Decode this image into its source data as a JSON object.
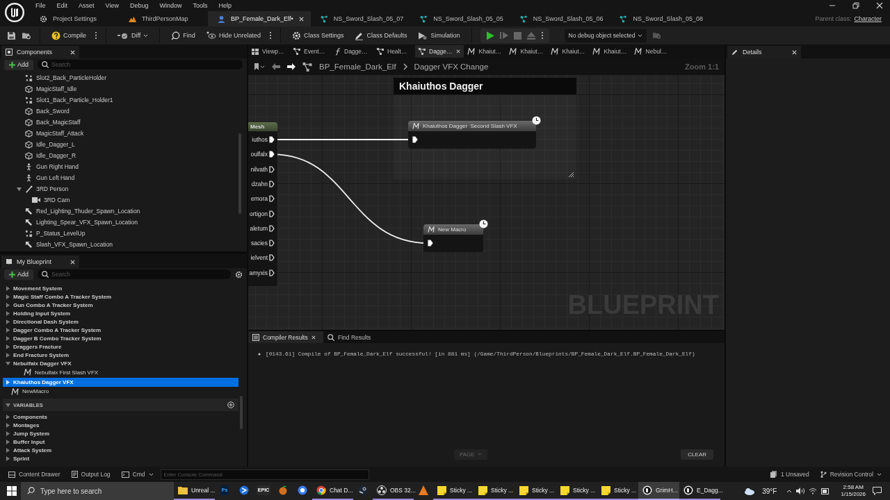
{
  "menu": [
    "File",
    "Edit",
    "Asset",
    "View",
    "Debug",
    "Window",
    "Tools",
    "Help"
  ],
  "doc_tabs": [
    {
      "label": "Project Settings",
      "kind": "settings",
      "selected": false
    },
    {
      "label": "ThirdPersonMap",
      "kind": "map",
      "selected": false
    },
    {
      "label": "BP_Female_Dark_Elf•",
      "kind": "blueprint",
      "selected": true
    },
    {
      "label": "NS_Sword_Slash_05_07",
      "kind": "niagara",
      "selected": false
    },
    {
      "label": "NS_Sword_Slash_05_05",
      "kind": "niagara",
      "selected": false
    },
    {
      "label": "NS_Sword_Slash_05_06",
      "kind": "niagara",
      "selected": false
    },
    {
      "label": "NS_Sword_Slash_05_08",
      "kind": "niagara",
      "selected": false
    }
  ],
  "parent_class": {
    "label": "Parent class:",
    "value": "Character"
  },
  "toolbar": {
    "compile": "Compile",
    "diff": "Diff",
    "find": "Find",
    "hide_unrelated": "Hide Unrelated",
    "class_settings": "Class Settings",
    "class_defaults": "Class Defaults",
    "simulation": "Simulation",
    "debug_object": "No debug object selected"
  },
  "components": {
    "title": "Components",
    "add": "Add",
    "search_placeholder": "Search",
    "items": [
      {
        "label": "Slot2_Back_ParticleHolder",
        "kind": "particle"
      },
      {
        "label": "MagicStaff_Idle",
        "kind": "mesh"
      },
      {
        "label": "Slot1_Back_Particle_Holder1",
        "kind": "particle"
      },
      {
        "label": "Back_Sword",
        "kind": "mesh"
      },
      {
        "label": "Back_MagicStaff",
        "kind": "mesh"
      },
      {
        "label": "MagicStaff_Attack",
        "kind": "mesh"
      },
      {
        "label": "Idle_Dagger_L",
        "kind": "mesh"
      },
      {
        "label": "Idle_Dagger_R",
        "kind": "mesh"
      },
      {
        "label": "Gun Right Hand",
        "kind": "skeletal"
      },
      {
        "label": "Gun Left Hand",
        "kind": "skeletal"
      },
      {
        "label": "3RD Person",
        "kind": "spring",
        "expanded": true,
        "children": [
          {
            "label": "3RD Cam",
            "kind": "camera"
          }
        ]
      },
      {
        "label": "Red_Lighting_Thuder_Spawn_Location",
        "kind": "arrow"
      },
      {
        "label": "Lighting_Spear_VFX_Spawn_Location",
        "kind": "arrow"
      },
      {
        "label": "P_Status_LevelUp",
        "kind": "particle"
      },
      {
        "label": "Slash_VFX_Spawn_Location",
        "kind": "arrow"
      }
    ]
  },
  "my_blueprint": {
    "title": "My Blueprint",
    "add": "Add",
    "search_placeholder": "Search",
    "items": [
      {
        "label": "Movement System",
        "kind": "category",
        "expanded": false,
        "selected": false
      },
      {
        "label": "Magic Staff Combo A Tracker System",
        "kind": "category",
        "expanded": false,
        "selected": false
      },
      {
        "label": "Gun Combo A Tracker System",
        "kind": "category",
        "expanded": false,
        "selected": false
      },
      {
        "label": "Holding Input System",
        "kind": "category",
        "expanded": false,
        "selected": false
      },
      {
        "label": "Directional Dash System",
        "kind": "category",
        "expanded": false,
        "selected": false
      },
      {
        "label": "Dagger Combo A Tracker System",
        "kind": "category",
        "expanded": false,
        "selected": false
      },
      {
        "label": "Dagger B Combo Tracker System",
        "kind": "category",
        "expanded": false,
        "selected": false
      },
      {
        "label": "Draggers Fracture",
        "kind": "category",
        "expanded": false,
        "selected": false
      },
      {
        "label": "End Fracture System",
        "kind": "category",
        "expanded": false,
        "selected": false
      },
      {
        "label": "Nebulfalx Dagger VFX",
        "kind": "category",
        "expanded": true,
        "selected": false,
        "children": [
          {
            "label": "Nebulfalx First Slash VFX",
            "kind": "macro",
            "selected": false
          }
        ]
      },
      {
        "label": "Khaiuthos Dagger VFX",
        "kind": "category",
        "expanded": false,
        "selected": true
      },
      {
        "label": "NewMacro",
        "kind": "macro",
        "selected": false
      }
    ],
    "variables": {
      "title": "VARIABLES",
      "expanded": true,
      "items": [
        {
          "label": "Components",
          "kind": "category",
          "expanded": false,
          "selected": false
        },
        {
          "label": "Montages",
          "kind": "category",
          "expanded": false,
          "selected": false
        },
        {
          "label": "Jump System",
          "kind": "category",
          "expanded": false,
          "selected": false
        },
        {
          "label": "Buffer Input",
          "kind": "category",
          "expanded": false,
          "selected": false
        },
        {
          "label": "Attack System",
          "kind": "category",
          "expanded": false,
          "selected": false
        },
        {
          "label": "Sprint",
          "kind": "category",
          "expanded": false,
          "selected": false
        }
      ]
    }
  },
  "graph_tabs": [
    {
      "label": "Viewp…",
      "kind": "viewport",
      "selected": false
    },
    {
      "label": "Event…",
      "kind": "graph",
      "selected": false
    },
    {
      "label": "Dagge…",
      "kind": "function",
      "selected": false
    },
    {
      "label": "Healt…",
      "kind": "graph",
      "selected": false
    },
    {
      "label": "Dagge…",
      "kind": "graph",
      "selected": true
    },
    {
      "label": "Khaiut…",
      "kind": "macro",
      "selected": false
    },
    {
      "label": "Khaiut…",
      "kind": "macro",
      "selected": false
    },
    {
      "label": "Khaiut…",
      "kind": "macro",
      "selected": false
    },
    {
      "label": "Khaiut…",
      "kind": "macro",
      "selected": false
    },
    {
      "label": "Nebul…",
      "kind": "macro",
      "selected": false
    }
  ],
  "breadcrumb": {
    "blueprint": "BP_Female_Dark_Elf",
    "graph": "Dagger VFX Change",
    "zoom": "Zoom 1:1"
  },
  "graph": {
    "comment": "Khaiuthos Dagger",
    "source_node": {
      "title": "Mesh",
      "pins": [
        {
          "label": "iuthos",
          "connected": true
        },
        {
          "label": "oulfalx",
          "connected": true
        },
        {
          "label": "nilvath",
          "connected": false
        },
        {
          "label": "dzahn",
          "connected": false
        },
        {
          "label": "emora",
          "connected": false
        },
        {
          "label": "ortigon",
          "connected": false
        },
        {
          "label": "aletum",
          "connected": false
        },
        {
          "label": "sacies",
          "connected": false
        },
        {
          "label": "ielvent",
          "connected": false
        },
        {
          "label": "amyxis",
          "connected": false
        }
      ]
    },
    "macro_nodes": [
      {
        "title": "Khaiuthos Dagger  Second Slash VFX"
      },
      {
        "title": "New Macro"
      }
    ],
    "watermark": "BLUEPRINT"
  },
  "details": {
    "title": "Details"
  },
  "results": {
    "tabs": [
      {
        "label": "Compiler Results",
        "selected": true
      },
      {
        "label": "Find Results",
        "selected": false
      }
    ],
    "messages": [
      "[0143.61] Compile of BP_Female_Dark_Elf successful! [in 881 ms] (/Game/ThirdPerson/Blueprints/BP_Female_Dark_Elf.BP_Female_Dark_Elf)"
    ],
    "page": {
      "label": "PAGE",
      "disabled": true
    },
    "clear": "CLEAR"
  },
  "status_bar": {
    "content_drawer": "Content Drawer",
    "output_log": "Output Log",
    "cmd": "Cmd",
    "console_placeholder": "Enter Console Command",
    "unsaved": "1 Unsaved",
    "revision_control": "Revision Control"
  },
  "taskbar": {
    "search_placeholder": "Type here to search",
    "apps": [
      {
        "label": "Unreal ...",
        "kind": "folder",
        "selected": false
      },
      {
        "kind": "ps",
        "icon_text": "Ps",
        "selected": false
      },
      {
        "kind": "bluecircle",
        "selected": false
      },
      {
        "kind": "epic",
        "icon_text": "EPIC",
        "selected": false
      },
      {
        "kind": "fruit",
        "selected": false
      },
      {
        "kind": "chat",
        "selected": false
      },
      {
        "label": "Chat D...",
        "kind": "chrome",
        "selected": false
      },
      {
        "kind": "steam",
        "selected": false
      },
      {
        "label": "OBS 32...",
        "kind": "obs",
        "selected": false
      },
      {
        "kind": "orange",
        "selected": false
      },
      {
        "label": "Sticky ...",
        "kind": "sticky",
        "selected": false
      },
      {
        "label": "Sticky ...",
        "kind": "sticky",
        "selected": false
      },
      {
        "label": "Sticky ...",
        "kind": "sticky",
        "selected": false
      },
      {
        "label": "Sticky ...",
        "kind": "sticky",
        "selected": false
      },
      {
        "label": "Sticky ...",
        "kind": "sticky",
        "selected": false
      },
      {
        "label": "GrimH...",
        "kind": "unreal",
        "selected": true
      },
      {
        "label": "E_Dagg...",
        "kind": "unreal",
        "selected": false
      }
    ],
    "weather": "39°F",
    "time": "2:58 AM",
    "date": "1/15/2026"
  }
}
